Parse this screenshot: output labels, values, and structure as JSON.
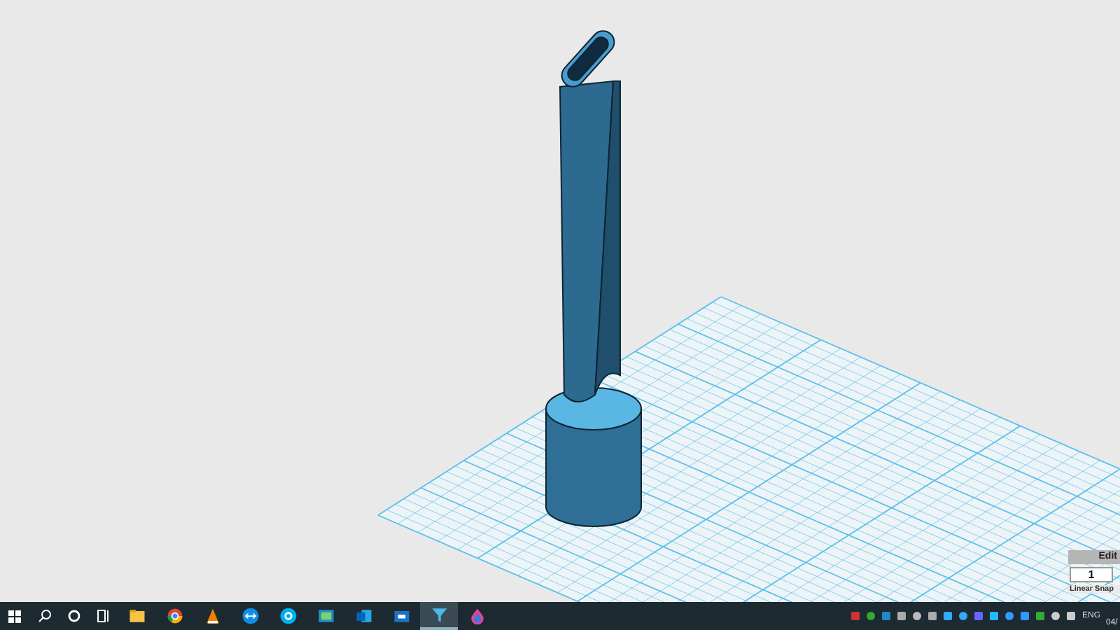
{
  "snap_panel": {
    "title": "Edit",
    "value": "1",
    "label": "Linear Snap"
  },
  "taskbar": {
    "apps": [
      {
        "kind": "folder",
        "selected": false
      },
      {
        "kind": "chrome",
        "selected": false
      },
      {
        "kind": "vlc",
        "selected": false
      },
      {
        "kind": "teamviewer",
        "selected": false
      },
      {
        "kind": "skype",
        "selected": false
      },
      {
        "kind": "photos",
        "selected": false
      },
      {
        "kind": "outlook",
        "selected": false
      },
      {
        "kind": "cube",
        "selected": false
      },
      {
        "kind": "funnel",
        "selected": true
      },
      {
        "kind": "drop",
        "selected": false
      }
    ],
    "language": "ENG",
    "clock": "04/"
  }
}
